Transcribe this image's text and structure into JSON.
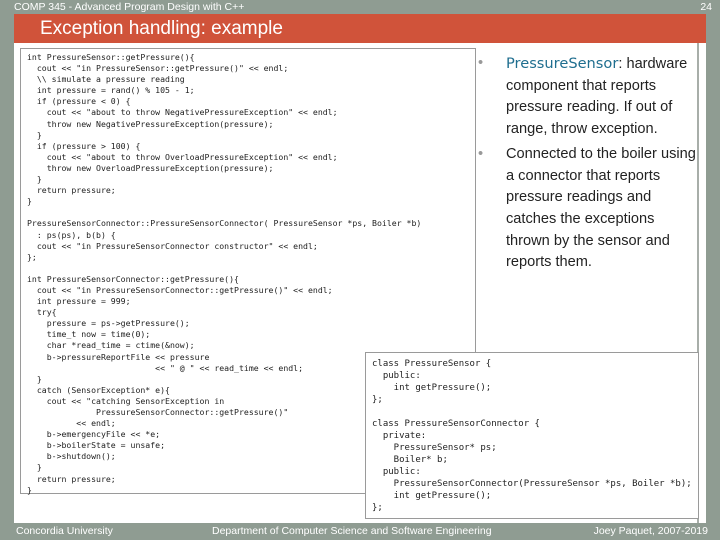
{
  "header": {
    "course": "COMP 345 - Advanced Program Design with C++",
    "slide_number": "24"
  },
  "title": "Exception handling: example",
  "code_main": [
    "int PressureSensor::getPressure(){",
    "  cout << \"in PressureSensor::getPressure()\" << endl;",
    "  \\\\ simulate a pressure reading",
    "  int pressure = rand() % 105 - 1;",
    "  if (pressure < 0) {",
    "    cout << \"about to throw NegativePressureException\" << endl;",
    "    throw new NegativePressureException(pressure);",
    "  }",
    "  if (pressure > 100) {",
    "    cout << \"about to throw OverloadPressureException\" << endl;",
    "    throw new OverloadPressureException(pressure);",
    "  }",
    "  return pressure;",
    "}",
    "",
    "PressureSensorConnector::PressureSensorConnector( PressureSensor *ps, Boiler *b)",
    "  : ps(ps), b(b) {",
    "  cout << \"in PressureSensorConnector constructor\" << endl;",
    "};",
    "",
    "int PressureSensorConnector::getPressure(){",
    "  cout << \"in PressureSensorConnector::getPressure()\" << endl;",
    "  int pressure = 999;",
    "  try{",
    "    pressure = ps->getPressure();",
    "    time_t now = time(0);",
    "    char *read_time = ctime(&now);",
    "    b->pressureReportFile << pressure",
    "                          << \" @ \" << read_time << endl;",
    "  }",
    "  catch (SensorException* e){",
    "    cout << \"catching SensorException in",
    "              PressureSensorConnector::getPressure()\"",
    "          << endl;",
    "    b->emergencyFile << *e;",
    "    b->boilerState = unsafe;",
    "    b->shutdown();",
    "  }",
    "  return pressure;",
    "}"
  ],
  "code_classes": [
    "class PressureSensor {",
    "  public:",
    "    int getPressure();",
    "};",
    "",
    "class PressureSensorConnector {",
    "  private:",
    "    PressureSensor* ps;",
    "    Boiler* b;",
    "  public:",
    "    PressureSensorConnector(PressureSensor *ps, Boiler *b);",
    "    int getPressure();",
    "};"
  ],
  "bullets": [
    {
      "keyword": "PressureSensor",
      "text": ": hardware component that reports pressure reading. If out of range, throw exception."
    },
    {
      "keyword": "",
      "text": "Connected to the boiler using a connector that reports pressure readings and catches the exceptions thrown by the sensor and reports them."
    }
  ],
  "footer": {
    "left": "Concordia University",
    "center": "Department of Computer Science and Software Engineering",
    "right": "Joey Paquet, 2007-2019"
  },
  "colors": {
    "background": "#8f9c92",
    "title_bar": "#d0533a",
    "keyword": "#1f6e8f"
  }
}
